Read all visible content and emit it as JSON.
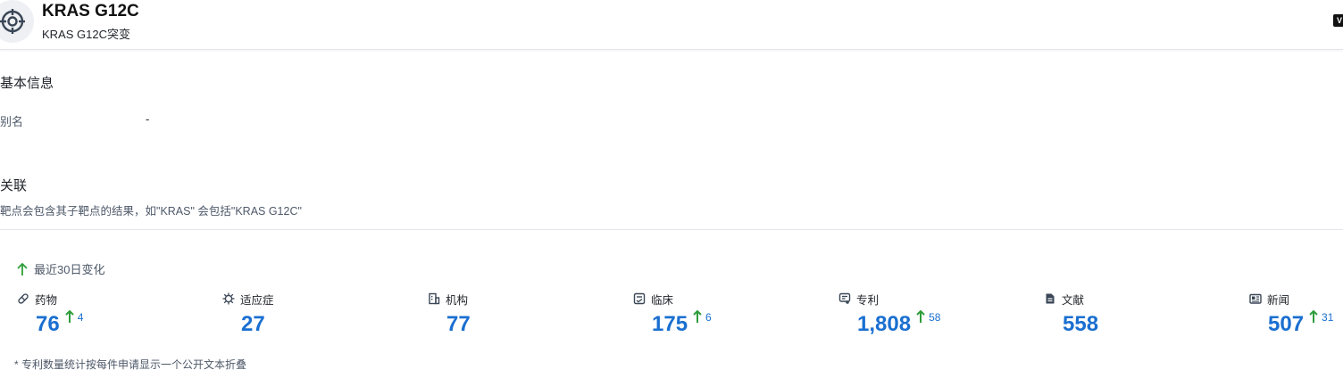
{
  "header": {
    "title": "KRAS G12C",
    "subtitle": "KRAS G12C突变",
    "corner_badge": "V"
  },
  "basic_info": {
    "title": "基本信息",
    "alias_label": "别名",
    "alias_value": "-"
  },
  "related": {
    "title": "关联",
    "description": "靶点会包含其子靶点的结果，如\"KRAS\" 会包括\"KRAS G12C\""
  },
  "change": {
    "label": "最近30日变化"
  },
  "stats": [
    {
      "label": "药物",
      "icon": "pill-icon",
      "value": "76",
      "delta": "4"
    },
    {
      "label": "适应症",
      "icon": "virus-icon",
      "value": "27",
      "delta": ""
    },
    {
      "label": "机构",
      "icon": "building-icon",
      "value": "77",
      "delta": ""
    },
    {
      "label": "临床",
      "icon": "clipboard-icon",
      "value": "175",
      "delta": "6"
    },
    {
      "label": "专利",
      "icon": "patent-icon",
      "value": "1,808",
      "delta": "58"
    },
    {
      "label": "文献",
      "icon": "document-icon",
      "value": "558",
      "delta": ""
    },
    {
      "label": "新闻",
      "icon": "newspaper-icon",
      "value": "507",
      "delta": "31"
    }
  ],
  "footnote": "* 专利数量统计按每件申请显示一个公开文本折叠",
  "colors": {
    "accent_blue": "#1a6fd0",
    "increase_green": "#2e9d3a",
    "text_muted": "#4e5969"
  }
}
